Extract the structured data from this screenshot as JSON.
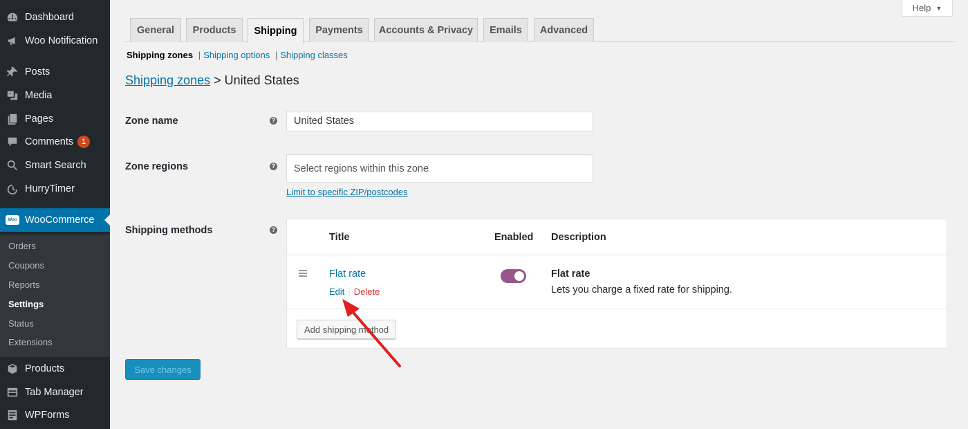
{
  "sidebar": {
    "items": [
      {
        "label": "Dashboard",
        "icon": "dashboard-icon"
      },
      {
        "label": "Woo Notification",
        "icon": "megaphone-icon"
      },
      {
        "label": "Posts",
        "icon": "pin-icon"
      },
      {
        "label": "Media",
        "icon": "media-icon"
      },
      {
        "label": "Pages",
        "icon": "pages-icon"
      },
      {
        "label": "Comments",
        "icon": "comment-icon",
        "badge": "1"
      },
      {
        "label": "Smart Search",
        "icon": "search-icon"
      },
      {
        "label": "HurryTimer",
        "icon": "timer-icon"
      },
      {
        "label": "WooCommerce",
        "icon": "woo-icon",
        "active": true
      },
      {
        "label": "Products",
        "icon": "box-icon"
      },
      {
        "label": "Tab Manager",
        "icon": "table-icon"
      },
      {
        "label": "WPForms",
        "icon": "forms-icon"
      }
    ],
    "submenu": [
      "Orders",
      "Coupons",
      "Reports",
      "Settings",
      "Status",
      "Extensions"
    ],
    "submenu_current": "Settings",
    "woo_logo_text": "Woo"
  },
  "help": {
    "label": "Help"
  },
  "tabs": [
    "General",
    "Products",
    "Shipping",
    "Payments",
    "Accounts & Privacy",
    "Emails",
    "Advanced"
  ],
  "active_tab": "Shipping",
  "subnav": {
    "current": "Shipping zones",
    "links": [
      "Shipping options",
      "Shipping classes"
    ]
  },
  "heading": {
    "link": "Shipping zones",
    "separator": ">",
    "zone": "United States"
  },
  "form": {
    "zone_name_label": "Zone name",
    "zone_name_value": "United States",
    "zone_regions_label": "Zone regions",
    "zone_regions_placeholder": "Select regions within this zone",
    "limit_link": "Limit to specific ZIP/postcodes",
    "shipping_methods_label": "Shipping methods",
    "help_glyph": "?"
  },
  "methods": {
    "headers": {
      "title": "Title",
      "enabled": "Enabled",
      "description": "Description"
    },
    "rows": [
      {
        "title": "Flat rate",
        "edit": "Edit",
        "delete": "Delete",
        "enabled": true,
        "desc_title": "Flat rate",
        "description": "Lets you charge a fixed rate for shipping."
      }
    ],
    "add_button": "Add shipping method"
  },
  "save_button": "Save changes",
  "colors": {
    "sidebar": "#23282d",
    "accent": "#0073aa",
    "toggle": "#96588a",
    "annotation": "#e02020",
    "delete": "#dc3232"
  }
}
